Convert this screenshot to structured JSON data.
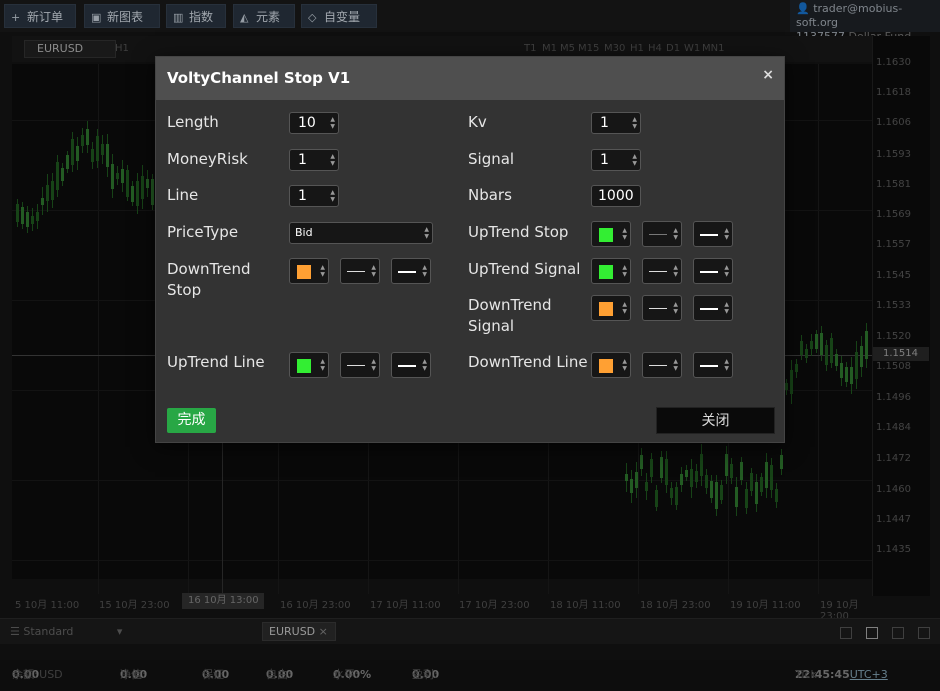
{
  "toolbar": {
    "buttons": [
      {
        "label": "新订单",
        "icon": "plus-icon"
      },
      {
        "label": "新图表",
        "icon": "chart-window-icon"
      },
      {
        "label": "指数",
        "icon": "bars-icon"
      },
      {
        "label": "元素",
        "icon": "shapes-icon"
      },
      {
        "label": "自变量",
        "icon": "diamond-icon"
      }
    ]
  },
  "account": {
    "email": "trader@mobius-soft.org",
    "number": "1137577",
    "fund": "Dollar Fund"
  },
  "chart": {
    "symbol": "EURUSD",
    "period": "H1",
    "timeframes": [
      "T1",
      "M1",
      "M5",
      "M15",
      "M30",
      "H1",
      "H4",
      "D1",
      "W1",
      "MN1"
    ],
    "price_labels": [
      "1.1630",
      "1.1618",
      "1.1606",
      "1.1593",
      "1.1581",
      "1.1569",
      "1.1557",
      "1.1545",
      "1.1533",
      "1.1520",
      "1.1514",
      "1.1508",
      "1.1496",
      "1.1484",
      "1.1472",
      "1.1460",
      "1.1447",
      "1.1435"
    ],
    "current_price": "1.1514",
    "time_labels": [
      "5 10月 11:00",
      "15 10月 23:00",
      "16 10月 13:00",
      "16 10月 23:00",
      "17 10月 11:00",
      "17 10月 23:00",
      "18 10月 11:00",
      "18 10月 23:00",
      "19 10月 11:00",
      "19 10月 23:00"
    ],
    "highlighted_time": "16 10月 13:00",
    "colors": {
      "bull": "#2f7a2f",
      "bear": "#1f5a1f"
    }
  },
  "bottom": {
    "layout_name": "Standard",
    "tab_symbol": "EURUSD",
    "tab_close": "×"
  },
  "status": {
    "balance_label": "余额:",
    "balance": "0.00",
    "balance_ccy": "USD",
    "equity_label": "净值:",
    "equity": "0.00",
    "margin_label": "保证金:",
    "margin": "0.00",
    "free_label": "自由:",
    "free": "0.00",
    "level_label": "水平:",
    "level": "0.00%",
    "profit_label": "盈利:",
    "profit": "0.00",
    "tick_label": "Tick",
    "time": "22:45:45",
    "tz": "UTC+3"
  },
  "dialog": {
    "title": "VoltyChannel Stop V1",
    "close_glyph": "×",
    "fields": {
      "length": {
        "label": "Length",
        "value": "10"
      },
      "moneyrisk": {
        "label": "MoneyRisk",
        "value": "1"
      },
      "line": {
        "label": "Line",
        "value": "1"
      },
      "pricetype": {
        "label": "PriceType",
        "value": "Bid"
      },
      "downtrend_stop": {
        "label": "DownTrend Stop"
      },
      "uptrend_line": {
        "label": "UpTrend Line"
      },
      "kv": {
        "label": "Kv",
        "value": "1"
      },
      "signal": {
        "label": "Signal",
        "value": "1"
      },
      "nbars": {
        "label": "Nbars",
        "value": "1000"
      },
      "uptrend_stop": {
        "label": "UpTrend Stop"
      },
      "uptrend_signal": {
        "label": "UpTrend Signal"
      },
      "downtrend_signal": {
        "label": "DownTrend Signal"
      },
      "downtrend_line": {
        "label": "DownTrend Line"
      }
    },
    "colors": {
      "green": "#33ee33",
      "orange": "#ffa033"
    },
    "ok_label": "完成",
    "close_label": "关闭"
  }
}
